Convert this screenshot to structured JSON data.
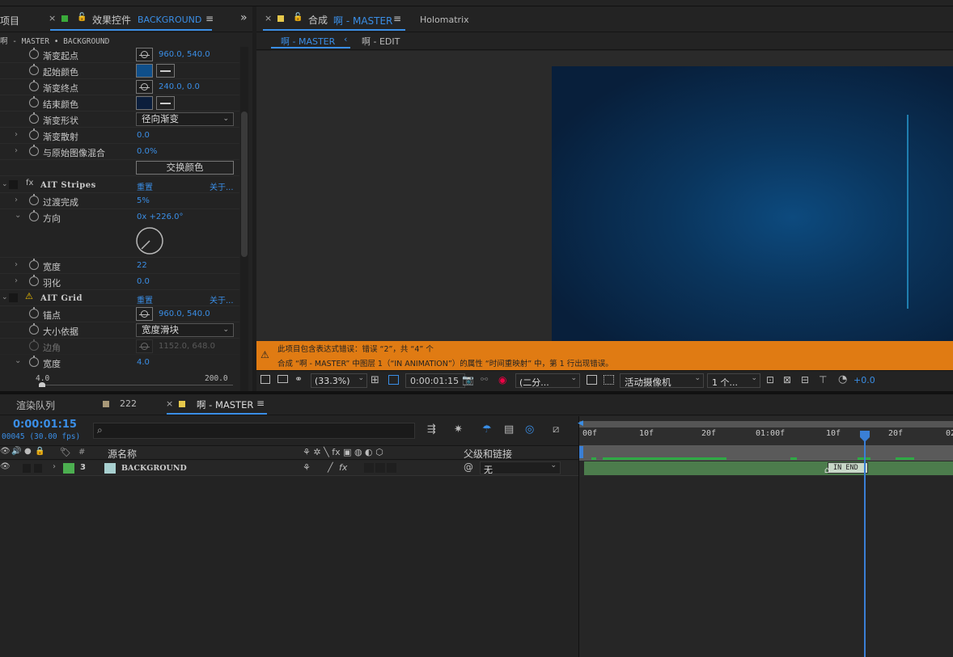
{
  "left_panel": {
    "tab_project": "项目",
    "tab_effects": "效果控件",
    "tab_effects_target": "BACKGROUND",
    "subtitle": "啊 - MASTER • BACKGROUND",
    "rows": {
      "start_point": {
        "label": "渐变起点",
        "value": "960.0, 540.0"
      },
      "start_color": {
        "label": "起始颜色",
        "color": "#0f4f8a"
      },
      "end_point": {
        "label": "渐变终点",
        "value": "240.0, 0.0"
      },
      "end_color": {
        "label": "结束颜色",
        "color": "#0b1e3c"
      },
      "shape": {
        "label": "渐变形状",
        "value": "径向渐变"
      },
      "scatter": {
        "label": "渐变散射",
        "value": "0.0"
      },
      "blend": {
        "label": "与原始图像混合",
        "value": "0.0%"
      },
      "swap_button": "交换颜色"
    },
    "stripes": {
      "name": "AIT Stripes",
      "reset": "重置",
      "about": "关于...",
      "transition": {
        "label": "过渡完成",
        "value": "5%"
      },
      "direction": {
        "label": "方向",
        "value": "0x +226.0°"
      },
      "width": {
        "label": "宽度",
        "value": "22"
      },
      "feather": {
        "label": "羽化",
        "value": "0.0"
      }
    },
    "grid": {
      "name": "AIT Grid",
      "reset": "重置",
      "about": "关于...",
      "anchor": {
        "label": "锚点",
        "value": "960.0, 540.0"
      },
      "size_by": {
        "label": "大小依据",
        "value": "宽度滑块"
      },
      "corner": {
        "label": "边角",
        "value": "1152.0, 648.0"
      },
      "width": {
        "label": "宽度",
        "value": "4.0"
      },
      "slider_min": "4.0",
      "slider_max": "200.0"
    }
  },
  "viewer": {
    "tab_comp": "合成",
    "tab_comp_name": "啊 - MASTER",
    "tab_other": "Holomatrix",
    "flow_active": "啊 - MASTER",
    "flow_other": "啊 - EDIT",
    "warning_line1": "此项目包含表达式错误：错误 “2”，共 “4” 个",
    "warning_line2": "合成 “啊 - MASTER” 中图层 1（“IN ANIMATION”）的属性 “时间重映射” 中，第 1 行出现错误。",
    "toolbar": {
      "zoom": "(33.3%)",
      "timecode": "0:00:01:15",
      "resolution": "(二分...",
      "camera": "活动摄像机",
      "views": "1 个...",
      "exposure": "+0.0"
    }
  },
  "timeline": {
    "tab_render": "渲染队列",
    "tab_222": "222",
    "tab_master": "啊 - MASTER",
    "timecode": "0:00:01:15",
    "frames": "00045 (30.00 fps)",
    "search_placeholder": "",
    "col_hash": "#",
    "col_source": "源名称",
    "col_parent": "父级和链接",
    "layer": {
      "num": "3",
      "name": "BACKGROUND",
      "parent": "无",
      "color": "#4caf50",
      "swatch": "#a8d0d0"
    },
    "ruler_labels": [
      "00f",
      "10f",
      "20f",
      "01:00f",
      "10f",
      "20f",
      "02"
    ],
    "marker_label": "IN END"
  }
}
